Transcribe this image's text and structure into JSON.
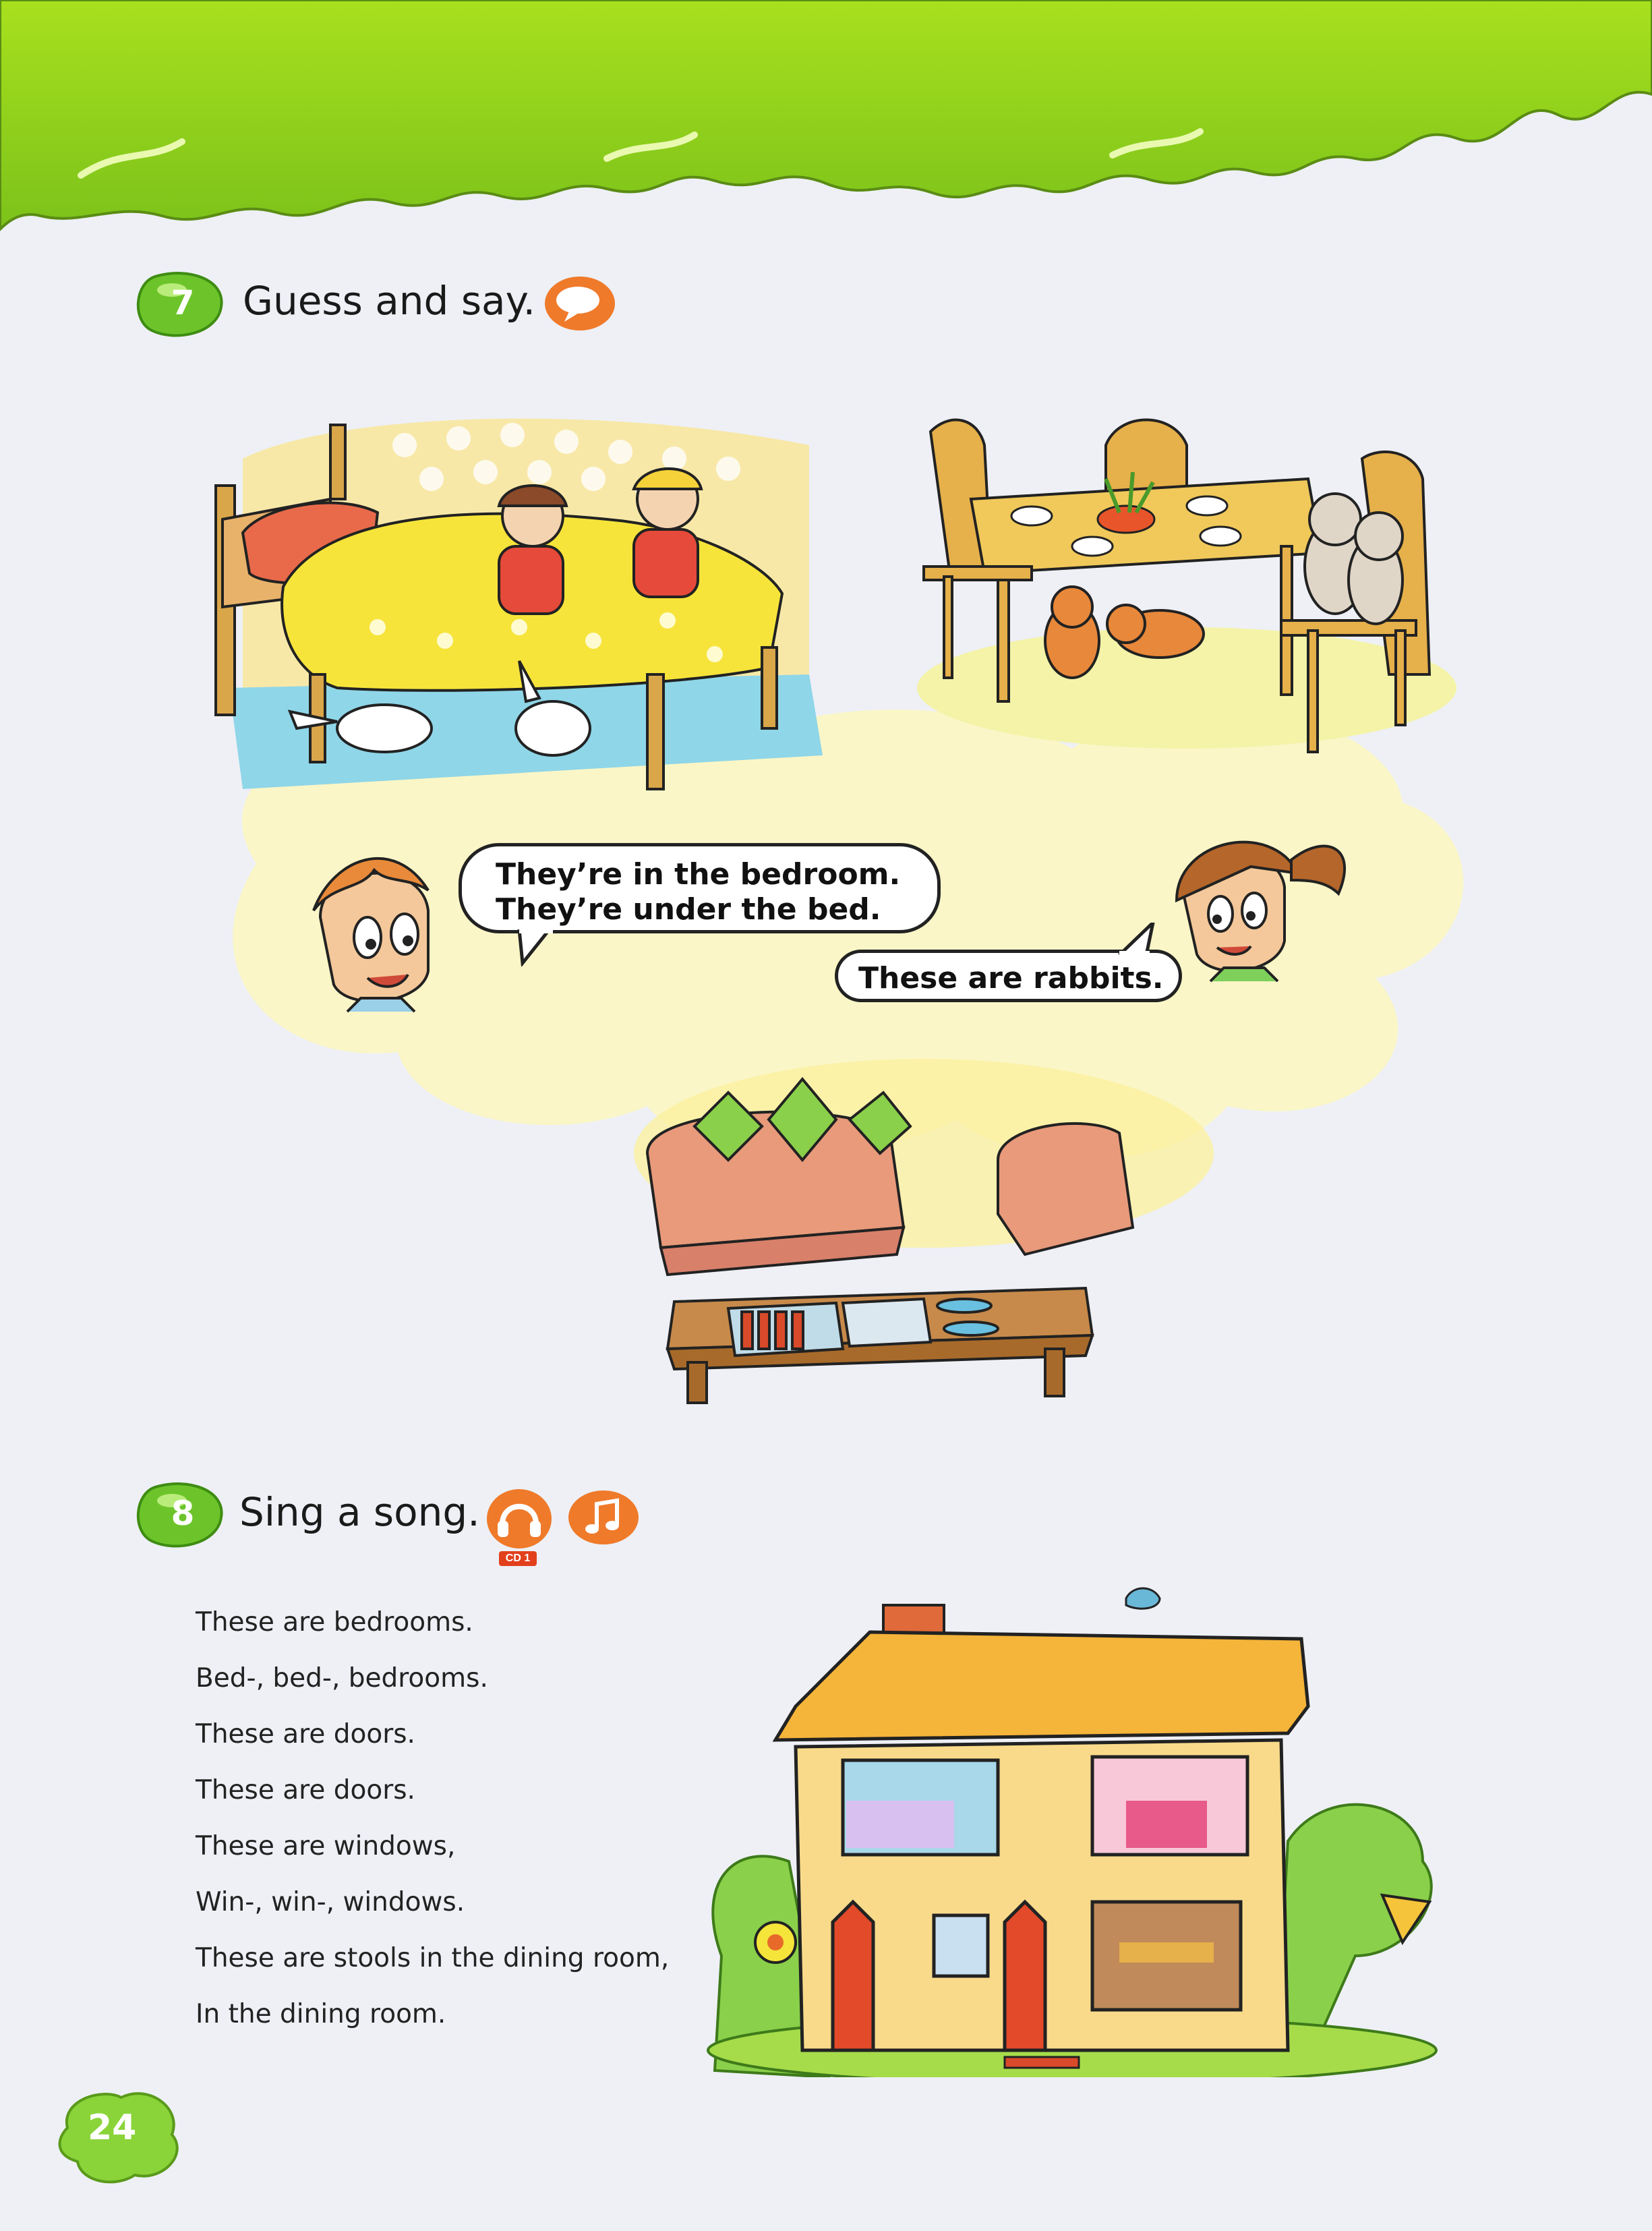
{
  "exercise7": {
    "number": "7",
    "title": "Guess and say.",
    "icon": "speech-bubble-icon",
    "boy_bubble_line1": "They’re in the bedroom.",
    "boy_bubble_line2": "They’re under the bed.",
    "girl_bubble": "These are rabbits."
  },
  "exercise8": {
    "number": "8",
    "title": "Sing a song.",
    "audio_icon": "headphones-icon",
    "cd_label": "CD 1",
    "music_icon": "music-note-icon",
    "lyrics": [
      "These are bedrooms.",
      "Bed-, bed-, bedrooms.",
      "These are doors.",
      "These are doors.",
      "These are windows,",
      "Win-, win-, windows.",
      "These are stools in the dining room,",
      "In the dining room."
    ]
  },
  "page_number": "24",
  "colors": {
    "header_green": "#96d41e",
    "badge_green": "#6cc42a",
    "icon_orange": "#ef7a2a",
    "thought_yellow": "#fbf5c4"
  }
}
